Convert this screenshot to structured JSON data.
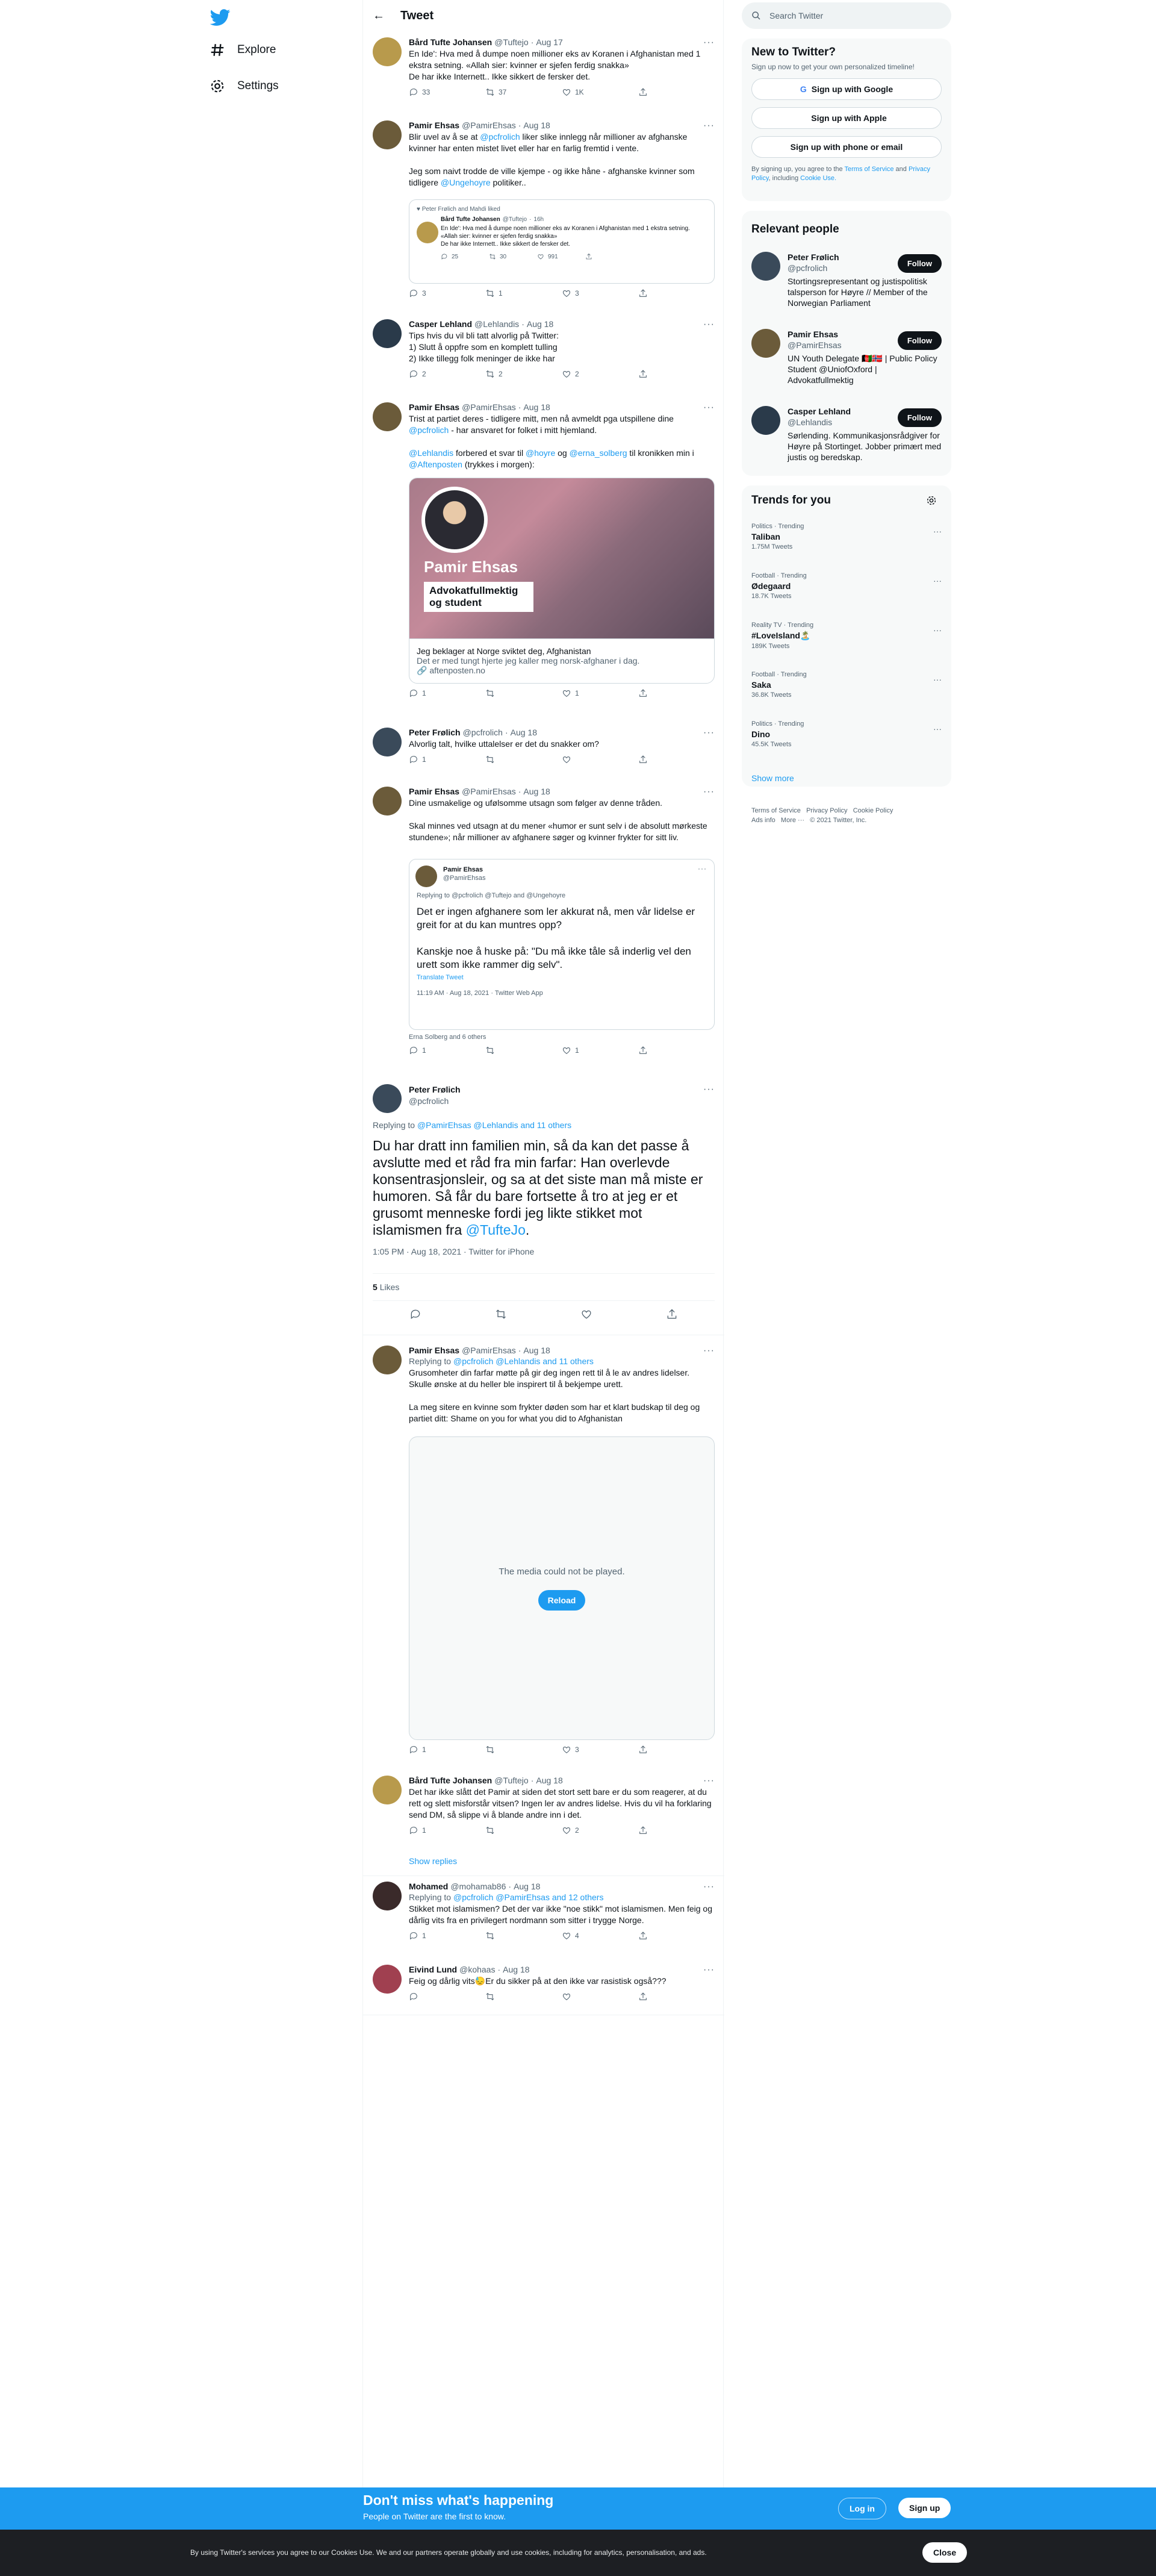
{
  "nav": {
    "explore": "Explore",
    "settings": "Settings"
  },
  "header": {
    "title": "Tweet"
  },
  "tweets": [
    {
      "name": "Bård Tufte Johansen",
      "handle": "@Tuftejo",
      "date": "Aug 17",
      "text": "En Ide': Hva med å dumpe noen millioner eks av Koranen i Afghanistan med 1 ekstra setning. «Allah sier: kvinner er sjefen ferdig snakka»\nDe har ikke Internett.. Ikke sikkert de fersker det.",
      "replies": "33",
      "retweets": "37",
      "likes": "1K"
    },
    {
      "name": "Pamir Ehsas",
      "handle": "@PamirEhsas",
      "date": "Aug 18",
      "text1": "Blir uvel av å se at",
      "mention1": "@pcfrolich",
      "text2": "liker slike innlegg når millioner av afghanske kvinner har enten mistet livet eller har en farlig fremtid i vente.",
      "text3": "Jeg som naivt trodde de ville kjempe - og ikke håne - afghanske kvinner som tidligere",
      "mention2": "@Ungehoyre",
      "text4": "politiker..",
      "replies": "3",
      "retweets": "1",
      "likes": "3",
      "quote": {
        "context": "Peter Frølich and Mahdi liked",
        "name": "Bård Tufte Johansen",
        "handle": "@Tuftejo",
        "time": "16h",
        "text": "En Ide': Hva med å dumpe noen millioner eks av Koranen i Afghanistan med 1 ekstra setning. «Allah sier: kvinner er sjefen ferdig snakka»\nDe har ikke Internett.. Ikke sikkert de fersker det.",
        "replies": "25",
        "retweets": "30",
        "likes": "991"
      }
    },
    {
      "name": "Casper Lehland",
      "handle": "@Lehlandis",
      "date": "Aug 18",
      "text": "Tips hvis du vil bli tatt alvorlig på Twitter:\n1) Slutt å oppfre som en komplett tulling\n2) Ikke tillegg folk meninger de ikke har",
      "replies": "2",
      "retweets": "2",
      "likes": "2"
    },
    {
      "name": "Pamir Ehsas",
      "handle": "@PamirEhsas",
      "date": "Aug 18",
      "text1": "Trist at partiet deres - tidligere mitt, men nå avmeldt pga utspillene dine",
      "mention1": "@pcfrolich",
      "text2": "- har ansvaret for folket i mitt hjemland.",
      "mention2": "@Lehlandis",
      "text3": "forbered et svar til",
      "mention3": "@hoyre",
      "text4": "og",
      "mention4": "@erna_solberg",
      "text5": "til kronikken min i",
      "mention5": "@Aftenposten",
      "text6": "(trykkes i morgen):",
      "card_name": "Pamir Ehsas",
      "card_role": "Advokatfullmektig og student",
      "card_title": "Jeg beklager at Norge sviktet deg, Afghanistan",
      "card_desc": "Det er med tungt hjerte jeg kaller meg norsk-afghaner i dag.",
      "card_domain": "aftenposten.no",
      "replies": "1",
      "retweets": "",
      "likes": "1"
    },
    {
      "name": "Peter Frølich",
      "handle": "@pcfrolich",
      "date": "Aug 18",
      "text": "Alvorlig talt, hvilke uttalelser er det du snakker om?",
      "replies": "1",
      "retweets": "",
      "likes": ""
    },
    {
      "name": "Pamir Ehsas",
      "handle": "@PamirEhsas",
      "date": "Aug 18",
      "text": "Dine usmakelige og ufølsomme utsagn som følger av denne tråden.\n\nSkal minnes ved utsagn at du mener «humor er sunt selv i de absolutt mørkeste stundene»; når millioner av afghanere søger og kvinner frykter for sitt liv.",
      "quote": {
        "name": "Pamir Ehsas",
        "handle": "@PamirEhsas",
        "replying": "Replying to @pcfrolich @Tuftejo and @Ungehoyre",
        "text1": "Det er ingen afghanere som ler akkurat nå, men vår lidelse er greit for at du kan muntres opp?",
        "text2": "Kanskje noe å huske på: \"Du må ikke tåle så inderlig vel den urett som ikke rammer dig selv\".",
        "translate": "Translate Tweet",
        "time": "11:19 AM · Aug 18, 2021 · Twitter Web App"
      },
      "liked_by": "Erna Solberg and 6 others",
      "replies": "1",
      "retweets": "",
      "likes": "1"
    }
  ],
  "main": {
    "name": "Peter Frølich",
    "handle": "@pcfrolich",
    "replying": "Replying to",
    "replying_links": "@PamirEhsas @Lehlandis and 11 others",
    "text": "Du har dratt inn familien min, så da kan det passe å avslutte med et råd fra min farfar: Han overlevde konsentrasjonsleir, og sa at det siste man må miste er humoren. Så får du bare fortsette å tro at jeg er et grusomt menneske fordi jeg likte stikket mot islamismen fra",
    "text_mention": "@TufteJo",
    "text_end": ".",
    "timestamp": "1:05 PM · Aug 18, 2021 · Twitter for iPhone",
    "likes_count": "5",
    "likes_label": "Likes"
  },
  "replies": [
    {
      "name": "Pamir Ehsas",
      "handle": "@PamirEhsas",
      "date": "Aug 18",
      "replying": "Replying to",
      "replying_links": "@pcfrolich @Lehlandis and 11 others",
      "text": "Grusomheter din farfar møtte på gir deg ingen rett til å le av andres lidelser. Skulle ønske at du heller ble inspirert til å bekjempe urett.\n\nLa meg sitere en kvinne som frykter døden som har et klart budskap til deg og partiet ditt: Shame on you for what you did to Afghanistan",
      "media_error": "The media could not be played.",
      "reload": "Reload",
      "replies": "1",
      "retweets": "",
      "likes": "3"
    },
    {
      "name": "Bård Tufte Johansen",
      "handle": "@Tuftejo",
      "date": "Aug 18",
      "text": "Det har ikke slått det Pamir at siden det stort sett bare er du som reagerer, at du rett og slett misforstår vitsen? Ingen ler av andres lidelse. Hvis du vil ha forklaring send DM, så slippe vi å blande andre inn i det.",
      "replies": "1",
      "retweets": "",
      "likes": "2",
      "show_replies": "Show replies"
    },
    {
      "name": "Mohamed",
      "handle": "@mohamab86",
      "date": "Aug 18",
      "replying": "Replying to",
      "replying_links": "@pcfrolich @PamirEhsas and 12 others",
      "text": "Stikket mot islamismen? Det der var ikke \"noe stikk\" mot islamismen. Men feig og dårlig vits fra en privilegert nordmann som sitter i trygge Norge.",
      "replies": "1",
      "retweets": "",
      "likes": "4"
    },
    {
      "name": "Eivind Lund",
      "handle": "@kohaas",
      "date": "Aug 18",
      "text": "Feig og dårlig vits😓Er du sikker på at den ikke var rasistisk også???",
      "replies": "",
      "retweets": "",
      "likes": ""
    }
  ],
  "right": {
    "search_placeholder": "Search Twitter",
    "new": {
      "title": "New to Twitter?",
      "sub": "Sign up now to get your own personalized timeline!",
      "google": "Sign up with Google",
      "apple": "Sign up with Apple",
      "phone": "Sign up with phone or email",
      "legal1": "By signing up, you agree to the",
      "tos": "Terms of Service",
      "and": "and",
      "privacy": "Privacy Policy",
      "legal2": ", including",
      "cookie": "Cookie Use."
    },
    "relevant": {
      "title": "Relevant people",
      "follow": "Follow",
      "people": [
        {
          "name": "Peter Frølich",
          "handle": "@pcfrolich",
          "bio": "Stortingsrepresentant og justispolitisk talsperson for Høyre // Member of the Norwegian Parliament"
        },
        {
          "name": "Pamir Ehsas",
          "handle": "@PamirEhsas",
          "bio": "UN Youth Delegate 🇦🇫🇳🇴 | Public Policy Student @UniofOxford | Advokatfullmektig"
        },
        {
          "name": "Casper Lehland",
          "handle": "@Lehlandis",
          "bio": "Sørlending. Kommunikasjonsrådgiver for Høyre på Stortinget. Jobber primært med justis og beredskap."
        }
      ]
    },
    "trends": {
      "title": "Trends for you",
      "items": [
        {
          "context": "Politics · Trending",
          "name": "Taliban",
          "count": "1.75M Tweets"
        },
        {
          "context": "Football · Trending",
          "name": "Ødegaard",
          "count": "18.7K Tweets"
        },
        {
          "context": "Reality TV · Trending",
          "name": "#LoveIsland🏝️",
          "count": "189K Tweets"
        },
        {
          "context": "Football · Trending",
          "name": "Saka",
          "count": "36.8K Tweets"
        },
        {
          "context": "Politics · Trending",
          "name": "Dino",
          "count": "45.5K Tweets"
        }
      ],
      "more": "Show more"
    },
    "footer": {
      "l1": "Terms of Service",
      "l2": "Privacy Policy",
      "l3": "Cookie Policy",
      "l4": "Ads info",
      "l5": "More ···",
      "l6": "© 2021 Twitter, Inc."
    }
  },
  "banner": {
    "title": "Don't miss what's happening",
    "sub": "People on Twitter are the first to know.",
    "login": "Log in",
    "signup": "Sign up"
  },
  "cookies": {
    "text": "By using Twitter's services you agree to our Cookies Use. We and our partners operate globally and use cookies, including for analytics, personalisation, and ads.",
    "close": "Close"
  },
  "colors": {
    "blue": "#1d9bf0",
    "banner": "#1d9bf0",
    "dark": "#1d1f23"
  }
}
